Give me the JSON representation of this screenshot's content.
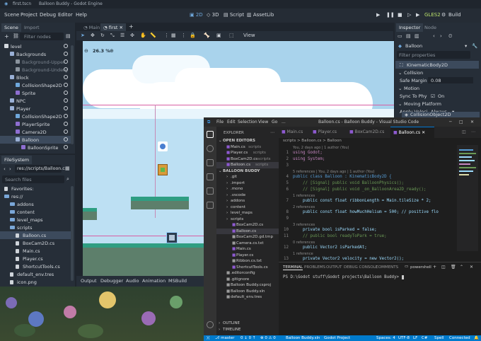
{
  "godot": {
    "title": "Balloon Buddy - Godot Engine",
    "title_prefix": "first.tscn",
    "menu": [
      "Scene",
      "Project",
      "Debug",
      "Editor",
      "Help"
    ],
    "workspaces": [
      "2D",
      "3D",
      "Script",
      "AssetLib"
    ],
    "renderer": "GLES2",
    "build_label": "Build",
    "scene_tabs": [
      "Main",
      "first"
    ],
    "view_label": "View",
    "zoom": "26.3 %",
    "left_dock": {
      "tabs": [
        "Scene",
        "Import"
      ],
      "filter_placeholder": "Filter nodes",
      "tree": [
        {
          "label": "level",
          "indent": 0
        },
        {
          "label": "Backgrounds",
          "indent": 1
        },
        {
          "label": "Background-Upper",
          "indent": 2
        },
        {
          "label": "Background-Underg",
          "indent": 2
        },
        {
          "label": "Block",
          "indent": 1
        },
        {
          "label": "CollisionShape2D",
          "indent": 2
        },
        {
          "label": "Sprite",
          "indent": 2
        },
        {
          "label": "NPC",
          "indent": 1
        },
        {
          "label": "Player",
          "indent": 1
        },
        {
          "label": "CollisionShape2D",
          "indent": 2
        },
        {
          "label": "PlayerSprite",
          "indent": 2
        },
        {
          "label": "Camera2D",
          "indent": 2
        },
        {
          "label": "Balloon",
          "indent": 2
        },
        {
          "label": "BalloonSprite",
          "indent": 3
        }
      ]
    },
    "filesystem": {
      "tab": "FileSystem",
      "path": "res://scripts/Balloon.c",
      "search_placeholder": "Search files",
      "items": [
        {
          "label": "Favorites:",
          "indent": 0,
          "folder": false
        },
        {
          "label": "res://",
          "indent": 0,
          "folder": true
        },
        {
          "label": "addons",
          "indent": 1,
          "folder": true
        },
        {
          "label": "content",
          "indent": 1,
          "folder": true
        },
        {
          "label": "level_maps",
          "indent": 1,
          "folder": true
        },
        {
          "label": "scripts",
          "indent": 1,
          "folder": true
        },
        {
          "label": "Balloon.cs",
          "indent": 2,
          "folder": false
        },
        {
          "label": "BoxCam2D.cs",
          "indent": 2,
          "folder": false
        },
        {
          "label": "Main.cs",
          "indent": 2,
          "folder": false
        },
        {
          "label": "Player.cs",
          "indent": 2,
          "folder": false
        },
        {
          "label": "ShortcutTools.cs",
          "indent": 2,
          "folder": false
        },
        {
          "label": "default_env.tres",
          "indent": 1,
          "folder": false
        },
        {
          "label": "icon.png",
          "indent": 1,
          "folder": false
        }
      ]
    },
    "inspector": {
      "tabs": [
        "Inspector",
        "Node"
      ],
      "node": "Balloon",
      "filter_placeholder": "Filter properties",
      "class": "KinematicBody2D",
      "collision_header": "Collision",
      "safe_margin_label": "Safe Margin",
      "safe_margin_value": "0.08",
      "motion_header": "Motion",
      "sync_label": "Sync To Phy",
      "sync_value": "On",
      "moving_platform": "Moving Platform",
      "apply_velocity_label": "Apply Veloci",
      "apply_velocity_value": "Always",
      "collision_object": "CollisionObject2D"
    },
    "bottom_tabs": [
      "Output",
      "Debugger",
      "Audio",
      "Animation",
      "MSBuild"
    ]
  },
  "vscode": {
    "title": "Balloon.cs - Balloon Buddy - Visual Studio Code",
    "menu": [
      "File",
      "Edit",
      "Selection",
      "View",
      "Go",
      "..."
    ],
    "explorer": "EXPLORER",
    "open_editors_header": "OPEN EDITORS",
    "open_editors": [
      {
        "name": "Main.cs",
        "dir": "scripts"
      },
      {
        "name": "Player.cs",
        "dir": "scripts"
      },
      {
        "name": "BoxCam2D.cs",
        "dir": "scripts"
      },
      {
        "name": "Balloon.cs",
        "dir": "scripts"
      }
    ],
    "project_header": "BALLOON BUDDY",
    "files": [
      ".git",
      ".import",
      ".mono",
      ".vscode",
      "addons",
      "content",
      "level_maps",
      "scripts",
      "BoxCam2D.cs",
      "Balloon.cs",
      "BoxCam2D.gd.tmp",
      "Camera.cs.txt",
      "Main.cs",
      "Player.cs",
      "Ribbon.cs.txt",
      "ShortcutTools.cs",
      ".editorconfig",
      ".gitignore",
      "Balloon Buddy.csproj",
      "Balloon Buddy.sln",
      "default_env.tres"
    ],
    "outline": "OUTLINE",
    "timeline": "TIMELINE",
    "tabs": [
      "Main.cs",
      "Player.cs",
      "BoxCam2D.cs",
      "Balloon.cs"
    ],
    "breadcrumb": "scripts > Balloon.cs > Balloon",
    "code": [
      {
        "ln": "",
        "hint": "You, 2 days ago | 1 author (You)"
      },
      {
        "ln": "1",
        "text": "using Godot;",
        "color": "#c586c0"
      },
      {
        "ln": "2",
        "text": "using System;",
        "color": "#c586c0"
      },
      {
        "ln": "3",
        "text": "",
        "color": "#d4d4d4"
      },
      {
        "ln": "",
        "hint": "5 references | You, 2 days ago | 1 author (You)"
      },
      {
        "ln": "4",
        "text": "public class Balloon : KinematicBody2D {",
        "color": "#569cd6"
      },
      {
        "ln": "5",
        "text": "    // [Signal] public void BalloonPhysics();",
        "color": "#6a9955"
      },
      {
        "ln": "6",
        "text": "    // [Signal] public void _on_BalloonArea2D_ready();",
        "color": "#6a9955"
      },
      {
        "ln": "",
        "hint": "1 references"
      },
      {
        "ln": "7",
        "text": "    public const float ribbonLength = Main.tileSize * 2;",
        "color": "#9cdcfe"
      },
      {
        "ln": "",
        "hint": "2 references"
      },
      {
        "ln": "8",
        "text": "    public const float howMuchHelium = 500; // positive flo",
        "color": "#9cdcfe"
      },
      {
        "ln": "9",
        "text": "",
        "color": "#d4d4d4"
      },
      {
        "ln": "",
        "hint": "3 references"
      },
      {
        "ln": "10",
        "text": "    private bool isParked = false;",
        "color": "#9cdcfe"
      },
      {
        "ln": "11",
        "text": "    // public bool readyToPark = true;",
        "color": "#6a9955"
      },
      {
        "ln": "",
        "hint": "0 references"
      },
      {
        "ln": "12",
        "text": "    public Vector2 isParkedAt;",
        "color": "#9cdcfe"
      },
      {
        "ln": "",
        "hint": "1 reference"
      },
      {
        "ln": "13",
        "text": "    private Vector2 velocity = new Vector2();",
        "color": "#9cdcfe"
      }
    ],
    "panel_tabs": [
      "TERMINAL",
      "PROBLEMS",
      "OUTPUT",
      "DEBUG CONSOLE",
      "COMMENTS"
    ],
    "terminal_label": "powershell",
    "terminal_prompt": "PS D:\\Godot stuff\\Godot projects\\Balloon Buddy> ",
    "status": {
      "branch": "master",
      "sync": "0 ↓ 0 ↑",
      "errors": "⊗ 0 ⚠ 0",
      "sln": "Balloon Buddy.sln",
      "project": "Godot Project",
      "spaces": "Spaces: 4",
      "encoding": "UTF-8",
      "eol": "LF",
      "lang": "C#",
      "spell": "Spell",
      "connected": "Connected"
    }
  },
  "colors": {
    "godot_bg": "#262e38",
    "accent": "#4a90d9",
    "vs_status": "#007acc",
    "grass": "#2f9e82",
    "sky": "#a9d3ec"
  }
}
